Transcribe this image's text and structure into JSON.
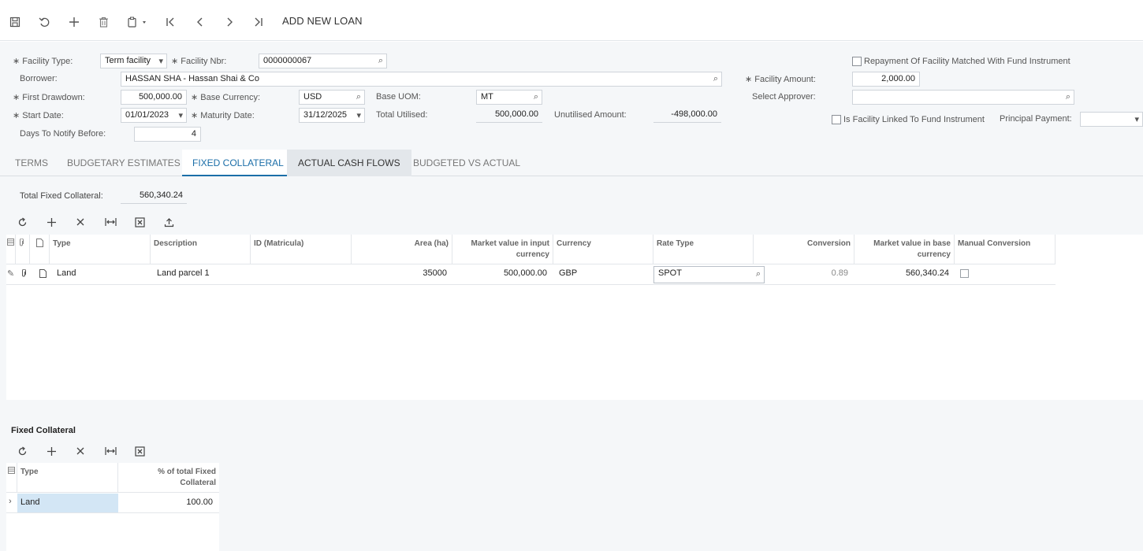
{
  "toolbar": {
    "title": "ADD NEW LOAN",
    "icons": [
      "save-icon",
      "undo-icon",
      "add-icon",
      "delete-icon",
      "copy-paste-icon",
      "first-record-icon",
      "previous-record-icon",
      "next-record-icon",
      "last-record-icon"
    ]
  },
  "form": {
    "facility_type_label": "Facility Type:",
    "facility_type_value": "Term facility",
    "facility_nbr_label": "Facility Nbr:",
    "facility_nbr_value": "0000000067",
    "borrower_label": "Borrower:",
    "borrower_value": "HASSAN SHA - Hassan Shai & Co",
    "first_drawdown_label": "First Drawdown:",
    "first_drawdown_value": "500,000.00",
    "base_currency_label": "Base Currency:",
    "base_currency_value": "USD",
    "base_uom_label": "Base UOM:",
    "base_uom_value": "MT",
    "start_date_label": "Start Date:",
    "start_date_value": "01/01/2023",
    "maturity_date_label": "Maturity Date:",
    "maturity_date_value": "31/12/2025",
    "total_utilised_label": "Total Utilised:",
    "total_utilised_value": "500,000.00",
    "unutilised_amount_label": "Unutilised Amount:",
    "unutilised_amount_value": "-498,000.00",
    "days_notify_label": "Days To Notify Before:",
    "days_notify_value": "4",
    "repayment_matched_label": "Repayment Of Facility Matched With Fund Instrument",
    "facility_amount_label": "Facility Amount:",
    "facility_amount_value": "2,000.00",
    "select_approver_label": "Select Approver:",
    "select_approver_value": "",
    "linked_fund_label": "Is Facility Linked To Fund Instrument",
    "principal_payment_label": "Principal Payment:",
    "principal_payment_value": ""
  },
  "tabs": [
    {
      "label": "TERMS"
    },
    {
      "label": "BUDGETARY ESTIMATES"
    },
    {
      "label": "FIXED COLLATERAL"
    },
    {
      "label": "ACTUAL CASH FLOWS"
    },
    {
      "label": "BUDGETED VS ACTUAL"
    }
  ],
  "collateral": {
    "total_label": "Total Fixed Collateral:",
    "total_value": "560,340.24",
    "columns": [
      "Type",
      "Description",
      "ID (Matricula)",
      "Area (ha)",
      "Market value in input currency",
      "Currency",
      "Rate Type",
      "Conversion",
      "Market value in base currency",
      "Manual Conversion"
    ],
    "rows": [
      {
        "type": "Land",
        "description": "Land parcel 1",
        "id": "",
        "area": "35000",
        "market_input": "500,000.00",
        "currency": "GBP",
        "rate_type": "SPOT",
        "conversion": "0.89",
        "market_base": "560,340.24"
      }
    ]
  },
  "fixed_collateral_summary": {
    "title": "Fixed Collateral",
    "columns": [
      "Type",
      "% of total Fixed Collateral"
    ],
    "rows": [
      {
        "type": "Land",
        "percent": "100.00"
      }
    ]
  }
}
